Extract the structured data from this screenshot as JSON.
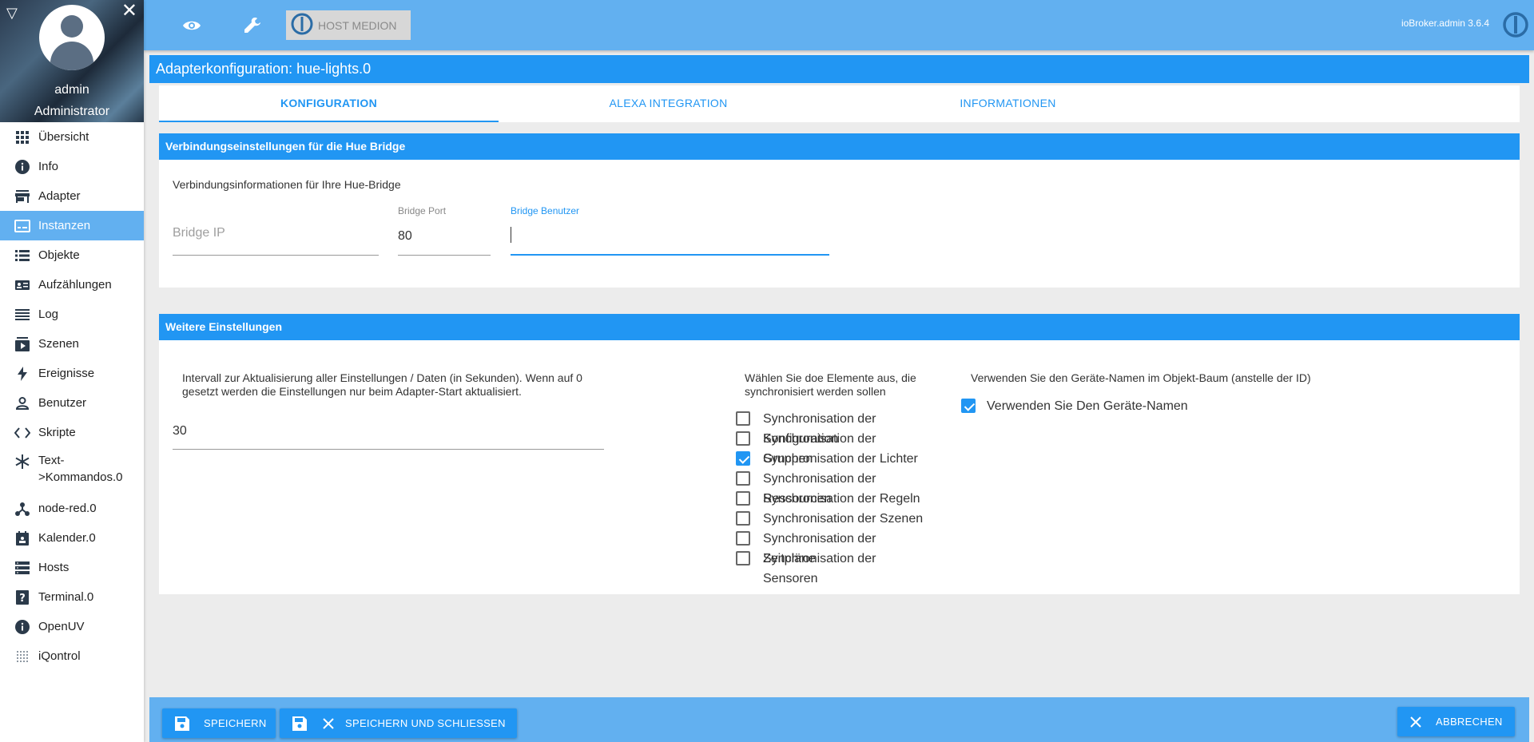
{
  "profile": {
    "name": "admin",
    "role": "Administrator"
  },
  "sidebar": {
    "items": [
      {
        "label": "Übersicht",
        "icon": "grid-icon"
      },
      {
        "label": "Info",
        "icon": "info-icon"
      },
      {
        "label": "Adapter",
        "icon": "store-icon"
      },
      {
        "label": "Instanzen",
        "icon": "instances-icon"
      },
      {
        "label": "Objekte",
        "icon": "list-icon"
      },
      {
        "label": "Aufzählungen",
        "icon": "enum-icon"
      },
      {
        "label": "Log",
        "icon": "log-icon"
      },
      {
        "label": "Szenen",
        "icon": "scenes-icon"
      },
      {
        "label": "Ereignisse",
        "icon": "bolt-icon"
      },
      {
        "label": "Benutzer",
        "icon": "user-icon"
      },
      {
        "label": "Skripte",
        "icon": "code-icon"
      },
      {
        "label": "Text->Kommandos.0",
        "icon": "snowflake-icon"
      },
      {
        "label": "node-red.0",
        "icon": "node-red-icon"
      },
      {
        "label": "Kalender.0",
        "icon": "calendar-icon"
      },
      {
        "label": "Hosts",
        "icon": "hosts-icon"
      },
      {
        "label": "Terminal.0",
        "icon": "terminal-icon"
      },
      {
        "label": "OpenUV",
        "icon": "info-icon"
      },
      {
        "label": "iQontrol",
        "icon": "dots-grid-icon"
      }
    ],
    "active": "Instanzen"
  },
  "topbar": {
    "host_label": "HOST MEDION",
    "version": "ioBroker.admin 3.6.4"
  },
  "title": "Adapterkonfiguration: hue-lights.0",
  "tabs": [
    {
      "label": "KONFIGURATION",
      "active": true
    },
    {
      "label": "ALEXA INTEGRATION",
      "active": false
    },
    {
      "label": "INFORMATIONEN",
      "active": false
    }
  ],
  "connection": {
    "header": "Verbindungseinstellungen für die Hue Bridge",
    "description": "Verbindungsinformationen für Ihre Hue-Bridge",
    "bridge_ip": {
      "placeholder": "Bridge IP",
      "value": ""
    },
    "bridge_port": {
      "label": "Bridge Port",
      "value": "80"
    },
    "bridge_user": {
      "label": "Bridge Benutzer",
      "value": ""
    }
  },
  "further": {
    "header": "Weitere Einstellungen",
    "interval_label": "Intervall zur Aktualisierung aller Einstellungen / Daten (in Sekunden). Wenn auf 0 gesetzt werden die Einstellungen nur beim Adapter-Start aktualisiert.",
    "interval_value": "30",
    "sync_label": "Wählen Sie doe Elemente aus, die synchronisiert werden sollen",
    "sync_items": [
      {
        "label": "Synchronisation der Konfiguration",
        "checked": false
      },
      {
        "label": "Synchronisation der Gruppen",
        "checked": false
      },
      {
        "label": "Synchronisation der Lichter",
        "checked": true
      },
      {
        "label": "Synchronisation der Ressourcen",
        "checked": false
      },
      {
        "label": "Synchronisation der Regeln",
        "checked": false
      },
      {
        "label": "Synchronisation der Szenen",
        "checked": false
      },
      {
        "label": "Synchronisation der Zeitpläne",
        "checked": false
      },
      {
        "label": "Synchronisation der Sensoren",
        "checked": false
      }
    ],
    "devname_label": "Verwenden Sie den Geräte-Namen im Objekt-Baum (anstelle der ID)",
    "devname_checkbox": {
      "label": "Verwenden Sie Den Geräte-Namen",
      "checked": true
    }
  },
  "buttons": {
    "save": "SPEICHERN",
    "save_close": "SPEICHERN UND SCHLIESSEN",
    "cancel": "ABBRECHEN"
  },
  "colors": {
    "primary": "#2196f3",
    "bar": "#62b0f0",
    "active_nav": "#62b0f0"
  }
}
